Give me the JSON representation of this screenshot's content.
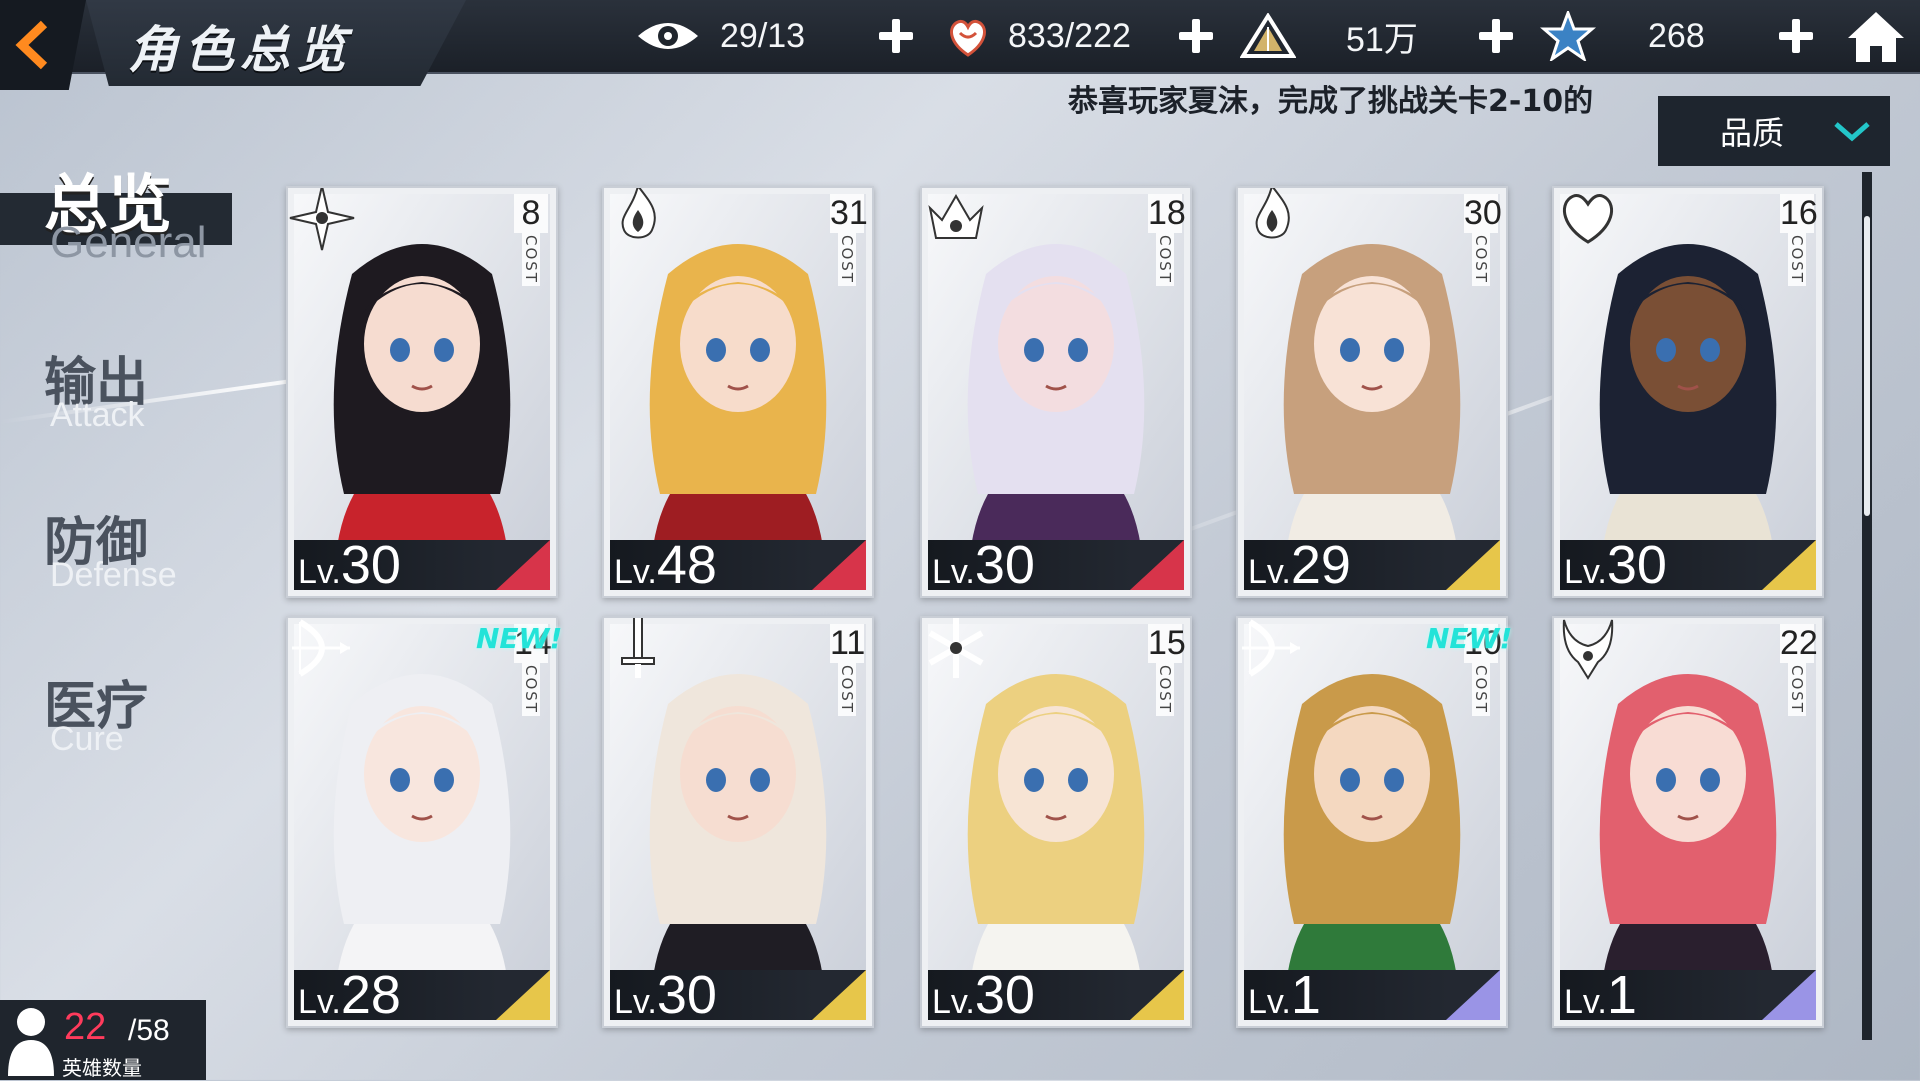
{
  "header": {
    "title": "角色总览",
    "resources": [
      {
        "icon": "eye-icon",
        "value": "29/13"
      },
      {
        "icon": "heart-hand-icon",
        "value": "833/222"
      },
      {
        "icon": "triangle-crystal-icon",
        "value": "51万"
      },
      {
        "icon": "star-shard-icon",
        "value": "268"
      }
    ]
  },
  "marquee": "恭喜玩家夏沫，完成了挑战关卡2-10的",
  "filter": {
    "label": "品质"
  },
  "tabs": [
    {
      "cn": "总览",
      "en": "General",
      "active": true
    },
    {
      "cn": "输出",
      "en": "Attack",
      "active": false
    },
    {
      "cn": "防御",
      "en": "Defense",
      "active": false
    },
    {
      "cn": "医疗",
      "en": "Cure",
      "active": false
    }
  ],
  "cards": [
    {
      "level": "30",
      "cost": "8",
      "role": "shuriken-icon",
      "accent": "#d7344a",
      "is_new": false,
      "hair": "#1e1a20",
      "outfit": "#c8232c",
      "skin": "#f6dcd0"
    },
    {
      "level": "48",
      "cost": "31",
      "role": "flame-icon",
      "accent": "#d7344a",
      "is_new": false,
      "hair": "#e9b44c",
      "outfit": "#9e1d22",
      "skin": "#f7dccb"
    },
    {
      "level": "30",
      "cost": "18",
      "role": "crown-emblem-icon",
      "accent": "#d7344a",
      "is_new": false,
      "hair": "#e4e0f0",
      "outfit": "#4a2a5a",
      "skin": "#f3dde0"
    },
    {
      "level": "29",
      "cost": "30",
      "role": "flame-icon",
      "accent": "#e7c64a",
      "is_new": false,
      "hair": "#c7a07d",
      "outfit": "#f1ece4",
      "skin": "#f8e2d6"
    },
    {
      "level": "30",
      "cost": "16",
      "role": "heart-shield-icon",
      "accent": "#e7c64a",
      "is_new": false,
      "hair": "#1c2233",
      "outfit": "#e9e3d5",
      "skin": "#7a4f35"
    },
    {
      "level": "28",
      "cost": "14",
      "role": "bow-icon",
      "accent": "#e7c64a",
      "is_new": true,
      "hair": "#eeeff3",
      "outfit": "#f4f4f6",
      "skin": "#f8e6de"
    },
    {
      "level": "30",
      "cost": "11",
      "role": "sword-icon",
      "accent": "#e7c64a",
      "is_new": false,
      "hair": "#efe6dc",
      "outfit": "#1f1d24",
      "skin": "#f6ddd1"
    },
    {
      "level": "30",
      "cost": "15",
      "role": "snowflake-icon",
      "accent": "#e7c64a",
      "is_new": false,
      "hair": "#ecd080",
      "outfit": "#f5f4f0",
      "skin": "#f7e4d4"
    },
    {
      "level": "1",
      "cost": "10",
      "role": "bow-icon",
      "accent": "#9a94e6",
      "is_new": true,
      "hair": "#c99a4a",
      "outfit": "#2f7a3a",
      "skin": "#f4d8c0"
    },
    {
      "level": "1",
      "cost": "22",
      "role": "demon-horns-icon",
      "accent": "#9a94e6",
      "is_new": false,
      "hair": "#e2606e",
      "outfit": "#2a1f2e",
      "skin": "#f8dcd4"
    }
  ],
  "card_text": {
    "lv_prefix": "Lv.",
    "cost_word": "COST",
    "new_tag": "NEW!"
  },
  "hero_count": {
    "current": "22",
    "max": "/58",
    "label": "英雄数量"
  }
}
